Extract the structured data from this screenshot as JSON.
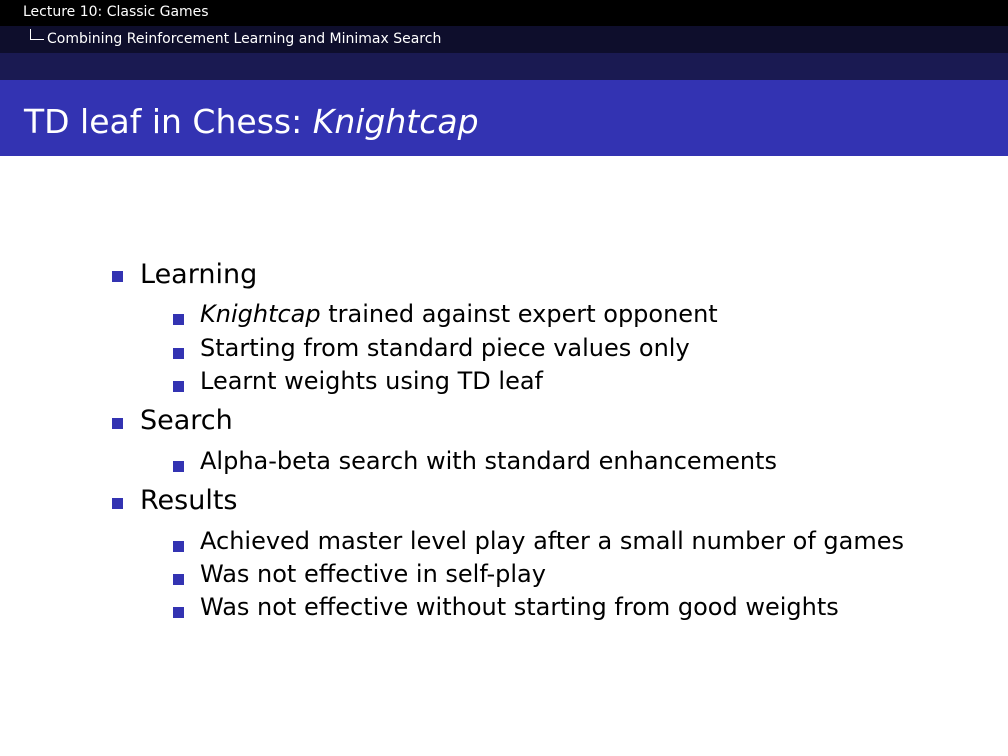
{
  "header": {
    "section": "Lecture 10: Classic Games",
    "subsection": "Combining Reinforcement Learning and Minimax Search"
  },
  "slide": {
    "title_plain": "TD leaf in Chess: ",
    "title_italic": "Knightcap"
  },
  "items": [
    {
      "label": "Learning",
      "sub": [
        {
          "italic": "Knightcap",
          "text": " trained against expert opponent"
        },
        {
          "text": "Starting from standard piece values only"
        },
        {
          "text": "Learnt weights using TD leaf"
        }
      ]
    },
    {
      "label": "Search",
      "sub": [
        {
          "text": "Alpha-beta search with standard enhancements"
        }
      ]
    },
    {
      "label": "Results",
      "sub": [
        {
          "text": "Achieved master level play after a small number of games"
        },
        {
          "text": "Was not effective in self-play"
        },
        {
          "text": "Was not effective without starting from good weights"
        }
      ]
    }
  ],
  "colors": {
    "bullet": "#3333b2",
    "title_bar": "#3333b2",
    "header_bar": "#000000"
  }
}
